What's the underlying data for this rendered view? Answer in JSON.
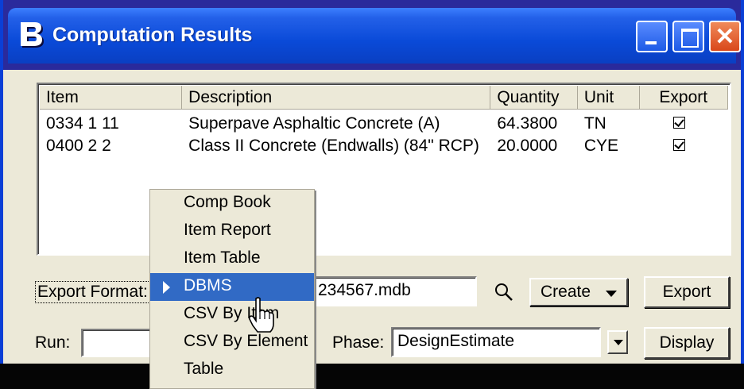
{
  "window": {
    "title": "Computation Results"
  },
  "table": {
    "columns": [
      "Item",
      "Description",
      "Quantity",
      "Unit",
      "Export"
    ],
    "rows": [
      {
        "item": "0334  1 11",
        "description": "Superpave Asphaltic Concrete (A)",
        "quantity": "64.3800",
        "unit": "TN",
        "export": true
      },
      {
        "item": "0400  2  2",
        "description": "Class II Concrete (Endwalls) (84\" RCP)",
        "quantity": "20.0000",
        "unit": "CYE",
        "export": true
      }
    ]
  },
  "controls": {
    "export_format_label": "Export Format:",
    "file_value": "234567.mdb",
    "create_label": "Create",
    "export_label": "Export",
    "run_label": "Run:",
    "run_value": "",
    "phase_label": "Phase:",
    "phase_value": "DesignEstimate",
    "display_label": "Display"
  },
  "menu": {
    "items": [
      "Comp Book",
      "Item Report",
      "Item Table",
      "DBMS",
      "CSV By Item",
      "CSV By Element",
      "Table"
    ],
    "selected": "DBMS"
  },
  "colors": {
    "title_blue": "#0a4ad8",
    "selection": "#316ac5",
    "background": "#2a2a9c"
  }
}
